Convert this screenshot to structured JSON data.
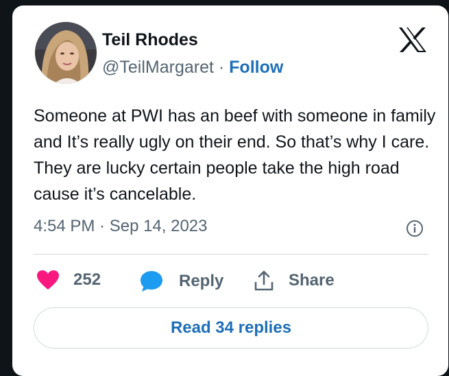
{
  "tweet": {
    "author_name": "Teil Rhodes",
    "handle": "@TeilMargaret",
    "separator": " · ",
    "follow_label": "Follow",
    "text": "Someone at PWI has an beef with someone in family and It’s really ugly on their end. So that’s why I care. They are lucky certain people take the high road cause it’s cancelable.",
    "timestamp": "4:54 PM · Sep 14, 2023"
  },
  "actions": {
    "like_count": "252",
    "reply_label": "Reply",
    "share_label": "Share"
  },
  "read_replies_label": "Read 34 replies",
  "icons": {
    "brand": "x-logo-icon",
    "info": "info-icon",
    "like": "heart-icon",
    "reply": "speech-bubble-icon",
    "share": "share-upload-icon"
  },
  "colors": {
    "like": "#f91880",
    "link": "#1d6fb8",
    "reply_icon": "#1d9bf0",
    "muted": "#536471"
  }
}
